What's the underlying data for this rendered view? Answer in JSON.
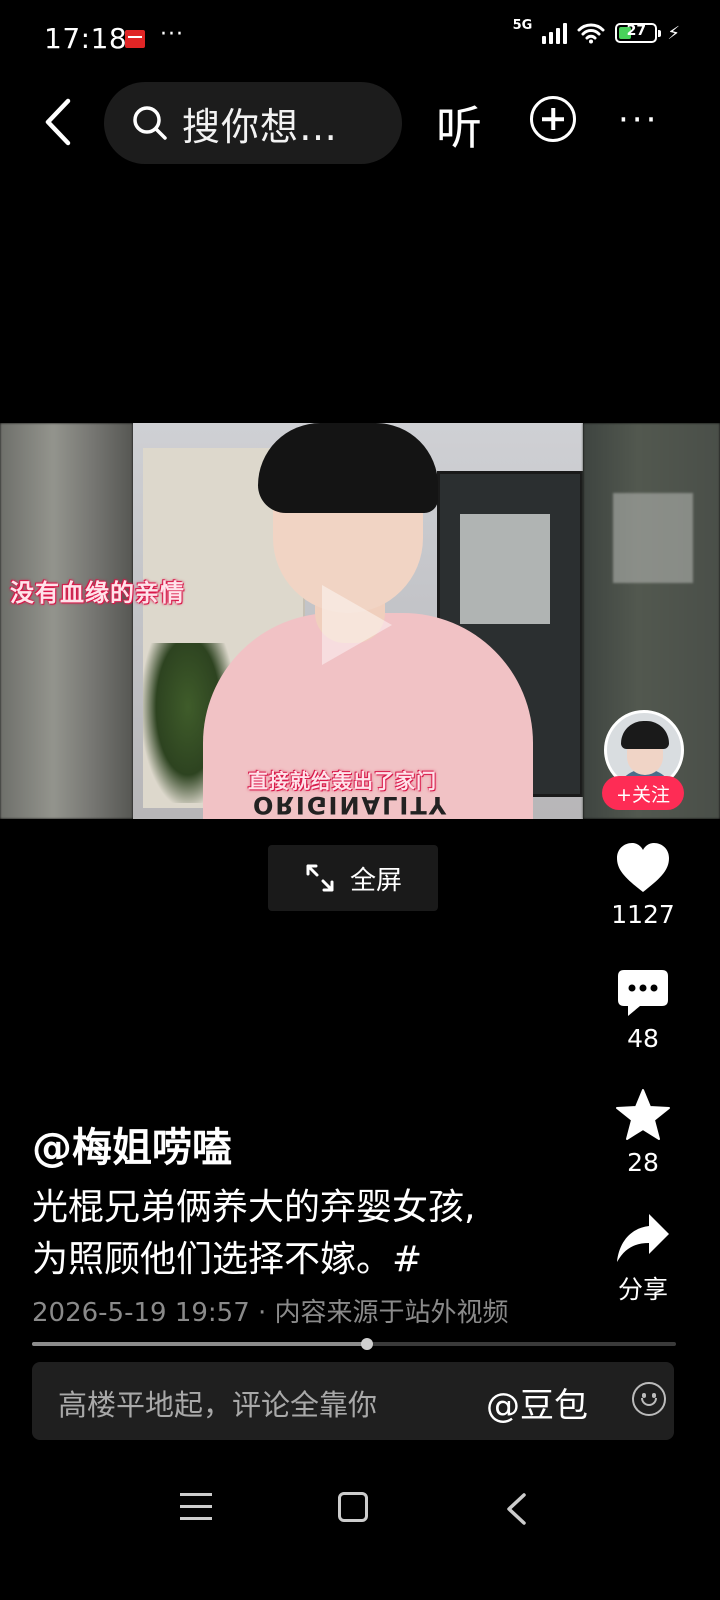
{
  "status_bar": {
    "time": "17:18",
    "dots": "···",
    "network": "5G",
    "battery": "27"
  },
  "top_bar": {
    "search_placeholder": "搜你想…",
    "listen_label": "听"
  },
  "video": {
    "caption_left": "没有血缘的亲情",
    "caption_bottom": "直接就给轰出了家门",
    "shirt_text": "ORIGINALITY"
  },
  "creator": {
    "follow_label": "+关注"
  },
  "fullscreen_label": "全屏",
  "actions": {
    "likes": "1127",
    "comments": "48",
    "favorites": "28",
    "share": "分享"
  },
  "post": {
    "author": "@梅姐唠嗑",
    "description_line1": "光棍兄弟俩养大的弃婴女孩,",
    "description_line2": "为照顾他们选择不嫁。#",
    "meta": "2026-5-19 19:57 · 内容来源于站外视频"
  },
  "progress": {
    "played_fraction": 0.52
  },
  "comment_bar": {
    "placeholder": "高楼平地起，评论全靠你",
    "mention": "@豆包"
  },
  "colors": {
    "follow": "#fe2c55",
    "battery": "#49d15b",
    "caption_outline": "#d8194a"
  }
}
